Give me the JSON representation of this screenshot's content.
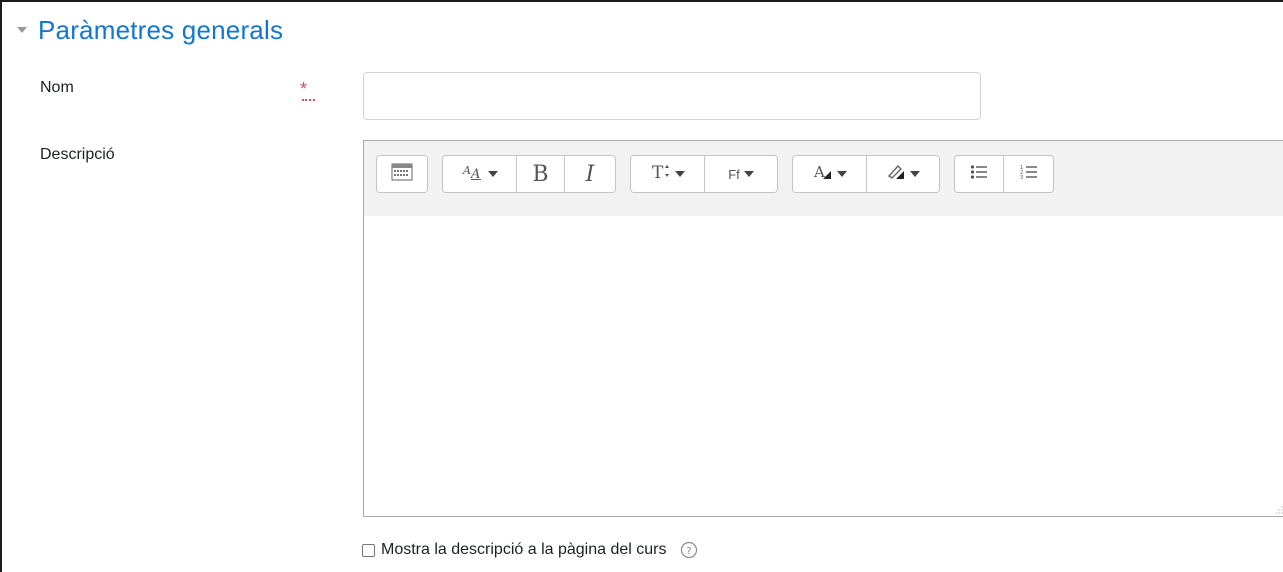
{
  "section": {
    "title": "Paràmetres generals"
  },
  "fields": {
    "name": {
      "label": "Nom",
      "value": "",
      "placeholder": "",
      "required_mark": "*"
    },
    "description": {
      "label": "Descripció"
    }
  },
  "toolbar": {
    "groups": [
      [
        "toolbar-toggle-icon"
      ],
      [
        "paragraph-styles-icon",
        "bold-icon",
        "italic-icon"
      ],
      [
        "font-size-icon",
        "font-family-icon"
      ],
      [
        "font-color-icon",
        "background-color-icon"
      ],
      [
        "unordered-list-icon",
        "ordered-list-icon"
      ]
    ],
    "bold_glyph": "B",
    "italic_glyph": "I",
    "font_family_glyph": "Ff"
  },
  "show_description": {
    "label": "Mostra la descripció a la pàgina del curs",
    "checked": false
  },
  "colors": {
    "accent": "#1177d1",
    "required": "#d9534f",
    "text": "#1d2125"
  }
}
